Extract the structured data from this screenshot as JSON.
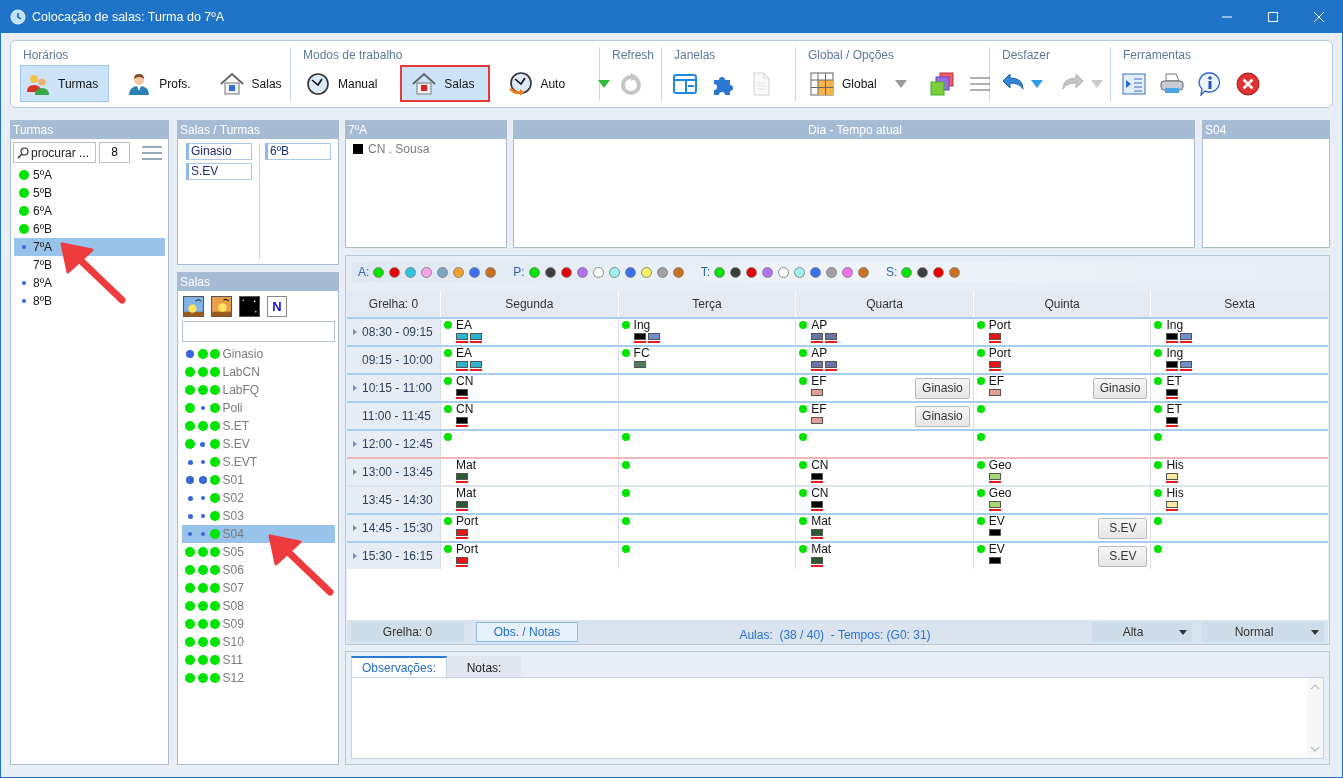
{
  "window": {
    "title": "Colocação de salas: Turma do 7ºA"
  },
  "ribbon": {
    "schedules": {
      "label": "Horários",
      "buttons": [
        {
          "label": "Turmas",
          "selected": true
        },
        {
          "label": "Profs.",
          "selected": false
        },
        {
          "label": "Salas",
          "selected": false
        }
      ]
    },
    "work_modes": {
      "label": "Modos de trabalho",
      "buttons": [
        {
          "label": "Manual",
          "selected": false,
          "annotated": false
        },
        {
          "label": "Salas",
          "selected": true,
          "annotated": true
        },
        {
          "label": "Auto",
          "selected": false,
          "annotated": false
        }
      ]
    },
    "refresh": {
      "label": "Refresh",
      "tools": [
        {
          "disabled": true
        }
      ]
    },
    "windows": {
      "label": "Janelas",
      "tools": [
        {
          "disabled": false
        },
        {
          "disabled": false
        },
        {
          "disabled": true
        }
      ]
    },
    "global_options": {
      "label": "Global / Opções",
      "selector": "Global",
      "tools": [
        {
          "disabled": false
        },
        {
          "disabled": true
        }
      ]
    },
    "undo": {
      "label": "Desfazer",
      "tools": [
        {
          "disabled": false
        },
        {
          "disabled": true
        }
      ]
    },
    "tools": {
      "label": "Ferramentas",
      "tools": [
        {
          "disabled": false
        },
        {
          "disabled": false
        },
        {
          "disabled": false
        },
        {
          "disabled": false
        }
      ]
    }
  },
  "classes_panel": {
    "title": "Turmas",
    "search": {
      "placeholder": "procurar ..."
    },
    "count": "8",
    "items": [
      {
        "label": "5ºA",
        "indicator": {
          "kind": "large",
          "color": "#00e400"
        },
        "selected": false,
        "annotated": false
      },
      {
        "label": "5ºB",
        "indicator": {
          "kind": "large",
          "color": "#00e400"
        },
        "selected": false,
        "annotated": false
      },
      {
        "label": "6ºA",
        "indicator": {
          "kind": "large",
          "color": "#00e400"
        },
        "selected": false,
        "annotated": false
      },
      {
        "label": "6ºB",
        "indicator": {
          "kind": "large",
          "color": "#00e400"
        },
        "selected": false,
        "annotated": false
      },
      {
        "label": "7ºA",
        "indicator": {
          "kind": "tiny",
          "color": "#3a64dc"
        },
        "selected": true,
        "annotated": true
      },
      {
        "label": "7ºB",
        "selected": false,
        "annotated": false
      },
      {
        "label": "8ºA",
        "indicator": {
          "kind": "tiny",
          "color": "#3a64dc"
        },
        "selected": false,
        "annotated": false
      },
      {
        "label": "8ºB",
        "indicator": {
          "kind": "tiny",
          "color": "#3a64dc"
        },
        "selected": false,
        "annotated": false
      }
    ]
  },
  "rooms_classes_panel": {
    "title": "Salas / Turmas",
    "column_1": [
      "Ginasio",
      "S.EV"
    ],
    "column_2": [
      "6ºB"
    ]
  },
  "rooms_panel": {
    "title": "Salas",
    "filter_buttons": [
      {
        "kind": "icon"
      },
      {
        "kind": "icon"
      },
      {
        "kind": "icon"
      },
      {
        "kind": "text",
        "label": "N"
      }
    ],
    "items": [
      {
        "label": "Ginasio",
        "indicators": [
          {
            "kind": "medium",
            "color": "#3a64dc"
          },
          {
            "kind": "large",
            "color": "#00e400"
          },
          {
            "kind": "large",
            "color": "#00e400"
          }
        ],
        "selected": false,
        "annotated": false
      },
      {
        "label": "LabCN",
        "indicators": [
          {
            "kind": "large",
            "color": "#00e400"
          },
          {
            "kind": "large",
            "color": "#00e400"
          },
          {
            "kind": "large",
            "color": "#00e400"
          }
        ],
        "selected": false,
        "annotated": false
      },
      {
        "label": "LabFQ",
        "indicators": [
          {
            "kind": "large",
            "color": "#00e400"
          },
          {
            "kind": "large",
            "color": "#00e400"
          },
          {
            "kind": "large",
            "color": "#00e400"
          }
        ],
        "selected": false,
        "annotated": false
      },
      {
        "label": "Poli",
        "indicators": [
          {
            "kind": "large",
            "color": "#00e400"
          },
          {
            "kind": "tiny",
            "color": "#3a64dc"
          },
          {
            "kind": "large",
            "color": "#00e400"
          }
        ],
        "selected": false,
        "annotated": false
      },
      {
        "label": "S.ET",
        "indicators": [
          {
            "kind": "large",
            "color": "#00e400"
          },
          {
            "kind": "large",
            "color": "#00e400"
          },
          {
            "kind": "large",
            "color": "#00e400"
          }
        ],
        "selected": false,
        "annotated": false
      },
      {
        "label": "S.EV",
        "indicators": [
          {
            "kind": "large",
            "color": "#00e400"
          },
          {
            "kind": "small",
            "color": "#3a64dc"
          },
          {
            "kind": "large",
            "color": "#00e400"
          }
        ],
        "selected": false,
        "annotated": false
      },
      {
        "label": "S.EVT",
        "indicators": [
          {
            "kind": "small",
            "color": "#3a64dc"
          },
          {
            "kind": "tiny",
            "color": "#3a64dc"
          },
          {
            "kind": "large",
            "color": "#00e400"
          }
        ],
        "selected": false,
        "annotated": false
      },
      {
        "label": "S01",
        "indicators": [
          {
            "kind": "medium",
            "color": "#3a64dc"
          },
          {
            "kind": "medium",
            "color": "#3a64dc"
          },
          {
            "kind": "large",
            "color": "#00e400"
          }
        ],
        "selected": false,
        "annotated": false
      },
      {
        "label": "S02",
        "indicators": [
          {
            "kind": "small",
            "color": "#3a64dc"
          },
          {
            "kind": "tiny",
            "color": "#3a64dc"
          },
          {
            "kind": "large",
            "color": "#00e400"
          }
        ],
        "selected": false,
        "annotated": false
      },
      {
        "label": "S03",
        "indicators": [
          {
            "kind": "small",
            "color": "#3a64dc"
          },
          {
            "kind": "tiny",
            "color": "#3a64dc"
          },
          {
            "kind": "large",
            "color": "#00e400"
          }
        ],
        "selected": false,
        "annotated": false
      },
      {
        "label": "S04",
        "indicators": [
          {
            "kind": "tiny",
            "color": "#3a64dc"
          },
          {
            "kind": "tiny",
            "color": "#3a64dc"
          },
          {
            "kind": "large",
            "color": "#00e400"
          }
        ],
        "selected": true,
        "annotated": true
      },
      {
        "label": "S05",
        "indicators": [
          {
            "kind": "large",
            "color": "#00e400"
          },
          {
            "kind": "large",
            "color": "#00e400"
          },
          {
            "kind": "large",
            "color": "#00e400"
          }
        ],
        "selected": false,
        "annotated": false
      },
      {
        "label": "S06",
        "indicators": [
          {
            "kind": "large",
            "color": "#00e400"
          },
          {
            "kind": "large",
            "color": "#00e400"
          },
          {
            "kind": "large",
            "color": "#00e400"
          }
        ],
        "selected": false,
        "annotated": false
      },
      {
        "label": "S07",
        "indicators": [
          {
            "kind": "large",
            "color": "#00e400"
          },
          {
            "kind": "large",
            "color": "#00e400"
          },
          {
            "kind": "large",
            "color": "#00e400"
          }
        ],
        "selected": false,
        "annotated": false
      },
      {
        "label": "S08",
        "indicators": [
          {
            "kind": "large",
            "color": "#00e400"
          },
          {
            "kind": "large",
            "color": "#00e400"
          },
          {
            "kind": "large",
            "color": "#00e400"
          }
        ],
        "selected": false,
        "annotated": false
      },
      {
        "label": "S09",
        "indicators": [
          {
            "kind": "large",
            "color": "#00e400"
          },
          {
            "kind": "large",
            "color": "#00e400"
          },
          {
            "kind": "large",
            "color": "#00e400"
          }
        ],
        "selected": false,
        "annotated": false
      },
      {
        "label": "S10",
        "indicators": [
          {
            "kind": "large",
            "color": "#00e400"
          },
          {
            "kind": "large",
            "color": "#00e400"
          },
          {
            "kind": "large",
            "color": "#00e400"
          }
        ],
        "selected": false,
        "annotated": false
      },
      {
        "label": "S11",
        "indicators": [
          {
            "kind": "large",
            "color": "#00e400"
          },
          {
            "kind": "large",
            "color": "#00e400"
          },
          {
            "kind": "large",
            "color": "#00e400"
          }
        ],
        "selected": false,
        "annotated": false
      },
      {
        "label": "S12",
        "indicators": [
          {
            "kind": "large",
            "color": "#00e400"
          },
          {
            "kind": "large",
            "color": "#00e400"
          },
          {
            "kind": "large",
            "color": "#00e400"
          }
        ],
        "selected": false,
        "annotated": false
      }
    ]
  },
  "class_panel": {
    "title": "7ºA",
    "entries": [
      {
        "label": "CN . Sousa",
        "color": "#000000"
      }
    ]
  },
  "day_panel": {
    "title": "Dia - Tempo atual"
  },
  "room_panel": {
    "title": "S04"
  },
  "legend": [
    {
      "label": "A:",
      "dots": [
        {
          "color": "#00e400"
        },
        {
          "color": "#e80000"
        },
        {
          "color": "#2ec4e0"
        },
        {
          "color": "#f6a0e6"
        },
        {
          "color": "#7aa6bf"
        },
        {
          "color": "#f4a030"
        },
        {
          "color": "#3a6ff0"
        },
        {
          "color": "#c87020"
        }
      ]
    },
    {
      "label": "P:",
      "dots": [
        {
          "color": "#00e400"
        },
        {
          "color": "#3c3c3c"
        },
        {
          "color": "#e80000"
        },
        {
          "color": "#b070f0"
        },
        {
          "color": "#ffffff"
        },
        {
          "color": "#9ef2f2"
        },
        {
          "color": "#3a6ff0"
        },
        {
          "color": "#f8f060"
        },
        {
          "color": "#a0a0a0"
        },
        {
          "color": "#c87020"
        }
      ]
    },
    {
      "label": "T:",
      "dots": [
        {
          "color": "#00e400"
        },
        {
          "color": "#3c3c3c"
        },
        {
          "color": "#e80000"
        },
        {
          "color": "#b070f0"
        },
        {
          "color": "#ffffff"
        },
        {
          "color": "#9ef2f2"
        },
        {
          "color": "#3a6ff0"
        },
        {
          "color": "#a0a0a0"
        },
        {
          "color": "#f070e8"
        },
        {
          "color": "#c87020"
        }
      ]
    },
    {
      "label": "S:",
      "dots": [
        {
          "color": "#00e400"
        },
        {
          "color": "#3c3c3c"
        },
        {
          "color": "#e80000"
        },
        {
          "color": "#c87020"
        }
      ]
    }
  ],
  "timetable": {
    "corner": "Grelha: 0",
    "days": [
      "Segunda",
      "Terça",
      "Quarta",
      "Quinta",
      "Sexta"
    ],
    "rows": [
      {
        "time": "08:30 - 09:15",
        "marker": true,
        "kind": "normal",
        "cells": [
          {
            "dot": true,
            "subject": "EA",
            "swatches": [
              {
                "color": "#2ab4d2"
              },
              {
                "color": "#2ab4d2"
              }
            ],
            "underlined": true
          },
          {
            "dot": true,
            "subject": "Ing",
            "swatches": [
              {
                "color": "#000000"
              },
              {
                "color": "#6f90cc"
              }
            ],
            "underlined": true
          },
          {
            "dot": true,
            "subject": "AP",
            "swatches": [
              {
                "color": "#6b76a6"
              },
              {
                "color": "#6b76a6"
              }
            ],
            "underlined": true
          },
          {
            "dot": true,
            "subject": "Port",
            "swatches": [
              {
                "color": "#e81414"
              }
            ],
            "underlined": true
          },
          {
            "dot": true,
            "subject": "Ing",
            "swatches": [
              {
                "color": "#000000"
              },
              {
                "color": "#6f90cc"
              }
            ],
            "underlined": true
          }
        ]
      },
      {
        "time": "09:15 - 10:00",
        "marker": false,
        "kind": "normal",
        "cells": [
          {
            "dot": true,
            "subject": "EA",
            "swatches": [
              {
                "color": "#2ab4d2"
              },
              {
                "color": "#2ab4d2"
              }
            ],
            "underlined": true
          },
          {
            "dot": true,
            "subject": "FC",
            "swatches": [
              {
                "color": "#4f7d58"
              }
            ],
            "underlined": false
          },
          {
            "dot": true,
            "subject": "AP",
            "swatches": [
              {
                "color": "#6b76a6"
              },
              {
                "color": "#6b76a6"
              }
            ],
            "underlined": true
          },
          {
            "dot": true,
            "subject": "Port",
            "swatches": [
              {
                "color": "#e81414"
              }
            ],
            "underlined": true
          },
          {
            "dot": true,
            "subject": "Ing",
            "swatches": [
              {
                "color": "#000000"
              },
              {
                "color": "#6f90cc"
              }
            ],
            "underlined": true
          }
        ]
      },
      {
        "time": "10:15 - 11:00",
        "marker": true,
        "kind": "normal",
        "cells": [
          {
            "dot": true,
            "subject": "CN",
            "swatches": [
              {
                "color": "#000000"
              }
            ],
            "underlined": true
          },
          {
            "dot": false
          },
          {
            "dot": true,
            "subject": "EF",
            "swatches": [
              {
                "color": "#e2a094"
              }
            ],
            "underlined": false,
            "room": "Ginasio"
          },
          {
            "dot": true,
            "subject": "EF",
            "swatches": [
              {
                "color": "#e2a094"
              }
            ],
            "underlined": false,
            "room": "Ginasio"
          },
          {
            "dot": true,
            "subject": "ET",
            "swatches": [
              {
                "color": "#000000"
              }
            ],
            "underlined": true
          }
        ]
      },
      {
        "time": "11:00 - 11:45",
        "marker": false,
        "kind": "normal",
        "cells": [
          {
            "dot": true,
            "subject": "CN",
            "swatches": [
              {
                "color": "#000000"
              }
            ],
            "underlined": true
          },
          {
            "dot": false
          },
          {
            "dot": true,
            "subject": "EF",
            "swatches": [
              {
                "color": "#e2a094"
              }
            ],
            "underlined": false,
            "room": "Ginasio"
          },
          {
            "dot": true
          },
          {
            "dot": true,
            "subject": "ET",
            "swatches": [
              {
                "color": "#000000"
              }
            ],
            "underlined": true
          }
        ]
      },
      {
        "time": "12:00 - 12:45",
        "marker": true,
        "kind": "normal",
        "cells": [
          {
            "dot": true
          },
          {
            "dot": true
          },
          {
            "dot": true
          },
          {
            "dot": true
          },
          {
            "dot": true
          }
        ]
      },
      {
        "time": "13:00 - 13:45",
        "marker": true,
        "kind": "break",
        "cells": [
          {
            "dot": false,
            "subject": "Mat",
            "swatches": [
              {
                "color": "#2d5a32"
              }
            ],
            "underlined": true
          },
          {
            "dot": true
          },
          {
            "dot": true,
            "subject": "CN",
            "swatches": [
              {
                "color": "#000000"
              }
            ],
            "underlined": true
          },
          {
            "dot": true,
            "subject": "Geo",
            "swatches": [
              {
                "color": "#a6d878"
              }
            ],
            "underlined": true
          },
          {
            "dot": true,
            "subject": "His",
            "swatches": [
              {
                "color": "#f8eaa0"
              }
            ],
            "underlined": true
          }
        ]
      },
      {
        "time": "13:45 - 14:30",
        "marker": false,
        "kind": "light",
        "cells": [
          {
            "dot": false,
            "subject": "Mat",
            "swatches": [
              {
                "color": "#2d5a32"
              }
            ],
            "underlined": true
          },
          {
            "dot": true
          },
          {
            "dot": true,
            "subject": "CN",
            "swatches": [
              {
                "color": "#000000"
              }
            ],
            "underlined": true
          },
          {
            "dot": true,
            "subject": "Geo",
            "swatches": [
              {
                "color": "#a6d878"
              }
            ],
            "underlined": true
          },
          {
            "dot": true,
            "subject": "His",
            "swatches": [
              {
                "color": "#f8eaa0"
              }
            ],
            "underlined": true
          }
        ]
      },
      {
        "time": "14:45 - 15:30",
        "marker": true,
        "kind": "normal",
        "cells": [
          {
            "dot": true,
            "subject": "Port",
            "swatches": [
              {
                "color": "#e81414"
              }
            ],
            "underlined": true
          },
          {
            "dot": true
          },
          {
            "dot": true,
            "subject": "Mat",
            "swatches": [
              {
                "color": "#2d5a32"
              }
            ],
            "underlined": true
          },
          {
            "dot": true,
            "subject": "EV",
            "swatches": [
              {
                "color": "#000000"
              }
            ],
            "underlined": false,
            "room": "S.EV"
          },
          {
            "dot": true
          }
        ]
      },
      {
        "time": "15:30 - 16:15",
        "marker": true,
        "kind": "normal",
        "cells": [
          {
            "dot": true,
            "subject": "Port",
            "swatches": [
              {
                "color": "#e81414"
              }
            ],
            "underlined": true
          },
          {
            "dot": true
          },
          {
            "dot": true,
            "subject": "Mat",
            "swatches": [
              {
                "color": "#2d5a32"
              }
            ],
            "underlined": true
          },
          {
            "dot": true,
            "subject": "EV",
            "swatches": [
              {
                "color": "#000000"
              }
            ],
            "underlined": false,
            "room": "S.EV"
          },
          {
            "dot": true
          }
        ]
      }
    ]
  },
  "status_bar": {
    "grid": "Grelha: 0",
    "notes_button": "Obs. / Notas",
    "summary": "Aulas:  (38 / 40)  - Tempos: (G0: 31)",
    "selectors": [
      {
        "value": "Alta"
      },
      {
        "value": "Normal"
      }
    ]
  },
  "notes": {
    "tabs": [
      {
        "label": "Observações:",
        "selected": true
      },
      {
        "label": "Notas:",
        "selected": false
      }
    ]
  }
}
